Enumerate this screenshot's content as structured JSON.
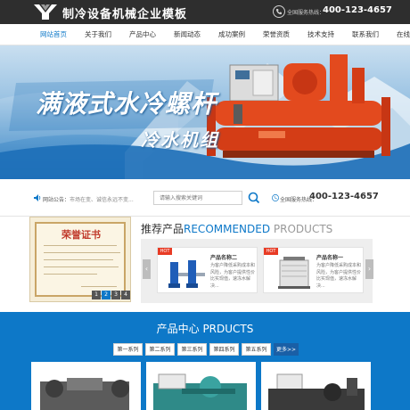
{
  "header": {
    "site_title": "制冷设备机械企业模板",
    "hotline_label": "全国服务热线：",
    "hotline_number": "400-123-4657"
  },
  "nav": {
    "items": [
      {
        "label": "网站首页",
        "active": true
      },
      {
        "label": "关于我们"
      },
      {
        "label": "产品中心"
      },
      {
        "label": "新闻动态"
      },
      {
        "label": "成功案例"
      },
      {
        "label": "荣誉资质"
      },
      {
        "label": "技术支持"
      },
      {
        "label": "联系我们"
      },
      {
        "label": "在线留言"
      }
    ]
  },
  "banner": {
    "title_a": "满液式水冷螺杆",
    "title_b": "冷水机组",
    "slides": 3,
    "active_slide": 2
  },
  "notice": {
    "label": "网站公告：",
    "text": "市场在变、诚信永远不变..."
  },
  "search": {
    "placeholder": "请输入搜索关键词"
  },
  "contact": {
    "label": "全国服务热线：",
    "number": "400-123-4657"
  },
  "certificate": {
    "title": "荣誉证书",
    "tabs": [
      "1",
      "2",
      "3",
      "4"
    ],
    "active_tab": "2"
  },
  "recommended": {
    "title_cn": "推荐产品",
    "title_en_a": "RECOMMENDED",
    "title_en_b": " PRODUCTS",
    "prev": "‹",
    "next": "›",
    "cards": [
      {
        "badge": "HOT",
        "name": "产品名称二",
        "desc": "为客户降低采购成本和风险，为客户提供性价比实现值，速冻水解决..."
      },
      {
        "badge": "HOT",
        "name": "产品名称一",
        "desc": "为客户降低采购成本和风险，为客户提供性价比实现值，速冻水解决..."
      }
    ]
  },
  "product_center": {
    "title": "产品中心 PRDUCTS",
    "tabs": [
      "第一系列",
      "第二系列",
      "第三系列",
      "第四系列",
      "第五系列"
    ],
    "more": "更多>>"
  },
  "colors": {
    "accent": "#0d78c8",
    "hot": "#e83b25",
    "header_bg": "#2e2e2e"
  }
}
